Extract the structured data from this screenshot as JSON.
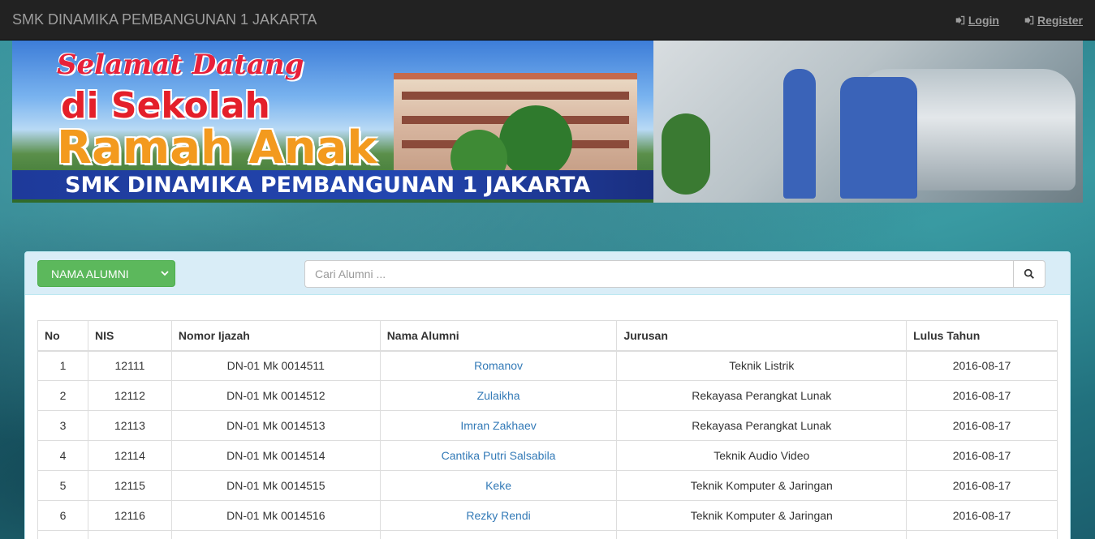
{
  "navbar": {
    "brand": "SMK DINAMIKA PEMBANGUNAN 1 JAKARTA",
    "login_label": "Login",
    "register_label": "Register"
  },
  "banner": {
    "welcome": "Selamat Datang",
    "line2": "di Sekolah",
    "line3": "Ramah Anak",
    "school": "SMK DINAMIKA PEMBANGUNAN 1 JAKARTA"
  },
  "filter": {
    "select_label": "NAMA ALUMNI",
    "search_placeholder": "Cari Alumni ..."
  },
  "table": {
    "headers": [
      "No",
      "NIS",
      "Nomor Ijazah",
      "Nama Alumni",
      "Jurusan",
      "Lulus Tahun"
    ],
    "rows": [
      {
        "no": "1",
        "nis": "12111",
        "ijazah": "DN-01 Mk 0014511",
        "nama": "Romanov",
        "jurusan": "Teknik Listrik",
        "lulus": "2016-08-17"
      },
      {
        "no": "2",
        "nis": "12112",
        "ijazah": "DN-01 Mk 0014512",
        "nama": "Zulaikha",
        "jurusan": "Rekayasa Perangkat Lunak",
        "lulus": "2016-08-17"
      },
      {
        "no": "3",
        "nis": "12113",
        "ijazah": "DN-01 Mk 0014513",
        "nama": "Imran Zakhaev",
        "jurusan": "Rekayasa Perangkat Lunak",
        "lulus": "2016-08-17"
      },
      {
        "no": "4",
        "nis": "12114",
        "ijazah": "DN-01 Mk 0014514",
        "nama": "Cantika Putri Salsabila",
        "jurusan": "Teknik Audio Video",
        "lulus": "2016-08-17"
      },
      {
        "no": "5",
        "nis": "12115",
        "ijazah": "DN-01 Mk 0014515",
        "nama": "Keke",
        "jurusan": "Teknik Komputer & Jaringan",
        "lulus": "2016-08-17"
      },
      {
        "no": "6",
        "nis": "12116",
        "ijazah": "DN-01 Mk 0014516",
        "nama": "Rezky Rendi",
        "jurusan": "Teknik Komputer & Jaringan",
        "lulus": "2016-08-17"
      }
    ]
  },
  "colors": {
    "navbar_bg": "#222222",
    "panel_heading": "#d9edf7",
    "select_green": "#5cb85c",
    "link_blue": "#337ab7"
  },
  "icons": {
    "login": "sign-in-icon",
    "register": "sign-in-icon",
    "search": "search-icon",
    "select": "chevron-down-icon"
  }
}
